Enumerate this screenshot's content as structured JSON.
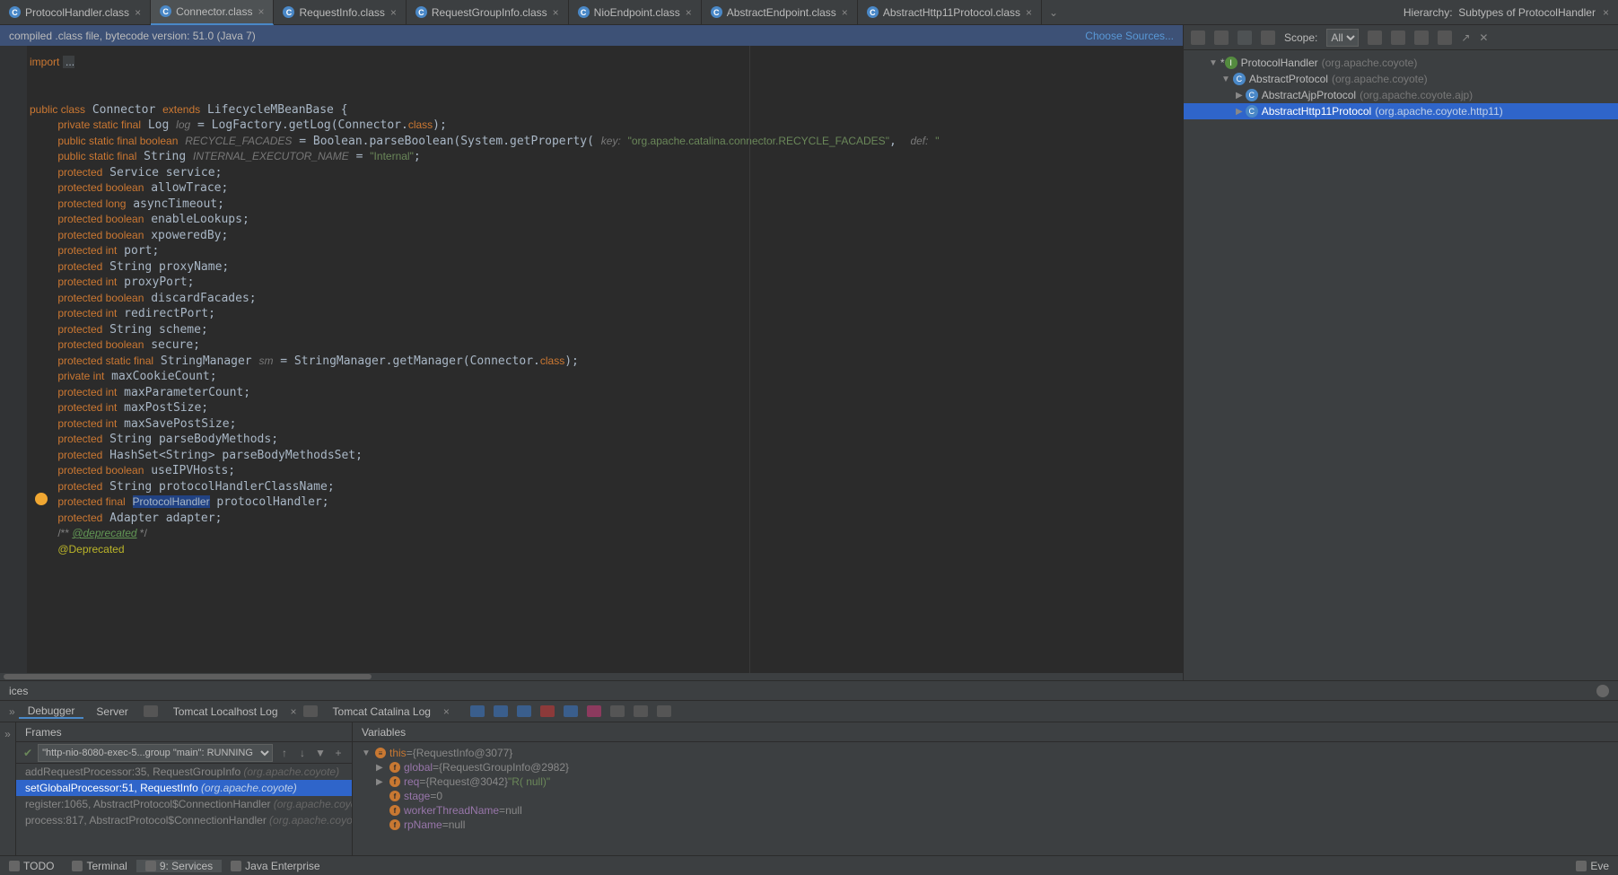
{
  "tabs": [
    {
      "label": "ProtocolHandler.class"
    },
    {
      "label": "Connector.class",
      "active": true
    },
    {
      "label": "RequestInfo.class"
    },
    {
      "label": "RequestGroupInfo.class"
    },
    {
      "label": "NioEndpoint.class"
    },
    {
      "label": "AbstractEndpoint.class"
    },
    {
      "label": "AbstractHttp11Protocol.class"
    }
  ],
  "infobar": {
    "left": "compiled .class file, bytecode version: 51.0 (Java 7)",
    "right": "Choose Sources..."
  },
  "hierarchy": {
    "title": "Hierarchy:",
    "sub": "Subtypes of ProtocolHandler",
    "scope_label": "Scope:",
    "scope_value": "All",
    "nodes": {
      "root": {
        "name": "ProtocolHandler",
        "pkg": "(org.apache.coyote)"
      },
      "c1": {
        "name": "AbstractProtocol",
        "pkg": "(org.apache.coyote)"
      },
      "c2": {
        "name": "AbstractAjpProtocol",
        "pkg": "(org.apache.coyote.ajp)"
      },
      "c3": {
        "name": "AbstractHttp11Protocol",
        "pkg": "(org.apache.coyote.http11)"
      }
    }
  },
  "services": {
    "title": "ices",
    "tabs": {
      "debugger": "Debugger",
      "server": "Server",
      "log1": "Tomcat Localhost Log",
      "log2": "Tomcat Catalina Log"
    },
    "frames": {
      "title": "Frames",
      "thread": "\"http-nio-8080-exec-5...group \"main\": RUNNING",
      "rows": [
        {
          "m": "addRequestProcessor:35, RequestGroupInfo",
          "p": "(org.apache.coyote)"
        },
        {
          "m": "setGlobalProcessor:51, RequestInfo",
          "p": "(org.apache.coyote)",
          "sel": true
        },
        {
          "m": "register:1065, AbstractProtocol$ConnectionHandler",
          "p": "(org.apache.coyo..."
        },
        {
          "m": "process:817, AbstractProtocol$ConnectionHandler",
          "p": "(org.apache.coyo..."
        }
      ]
    },
    "vars": {
      "title": "Variables",
      "rows": [
        {
          "ind": 0,
          "arr": "▼",
          "ico": "≡",
          "name": "this",
          "eq": " = ",
          "val": "{RequestInfo@3077}",
          "ncol": "#c87832"
        },
        {
          "ind": 1,
          "arr": "▶",
          "ico": "f",
          "name": "global",
          "eq": " = ",
          "val": "{RequestGroupInfo@2982}"
        },
        {
          "ind": 1,
          "arr": "▶",
          "ico": "f",
          "name": "req",
          "eq": " = ",
          "val": "{Request@3042}",
          "str": " \"R( null)\""
        },
        {
          "ind": 1,
          "arr": "",
          "ico": "f",
          "name": "stage",
          "eq": " = ",
          "val": "0"
        },
        {
          "ind": 1,
          "arr": "",
          "ico": "f",
          "name": "workerThreadName",
          "eq": " = ",
          "val": "null"
        },
        {
          "ind": 1,
          "arr": "",
          "ico": "f",
          "name": "rpName",
          "eq": " = ",
          "val": "null"
        }
      ]
    }
  },
  "statusbar": {
    "todo": "TODO",
    "terminal": "Terminal",
    "services": "9: Services",
    "java": "Java Enterprise",
    "ev": "Eve"
  },
  "code": {
    "import": "import ",
    "dots": "...",
    "facades_str": "\"org.apache.catalina.connector.RECYCLE_FACADES\"",
    "internal": "\"Internal\"",
    "key": "key:",
    "def": "def:",
    "decl_open": "public class Connector extends LifecycleMBeanBase {"
  }
}
